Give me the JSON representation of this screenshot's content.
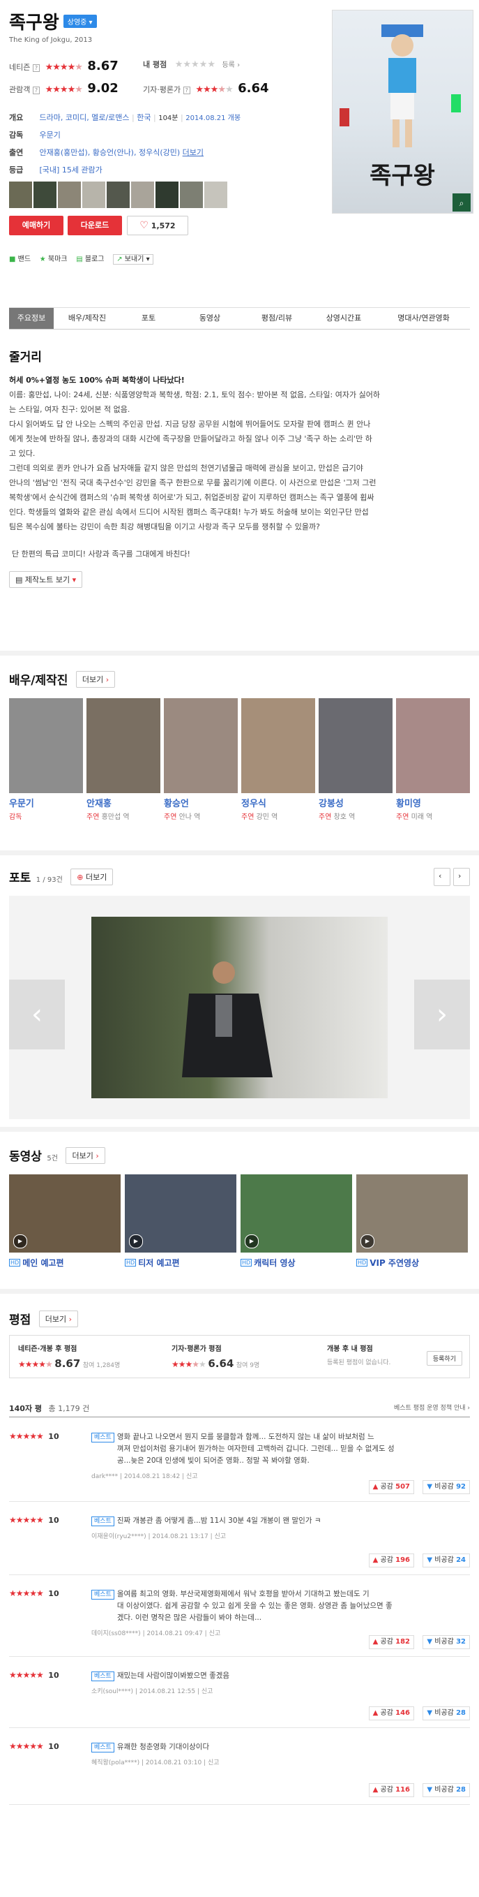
{
  "movie": {
    "title": "족구왕",
    "status_badge": "상영중",
    "subtitle": "The King of Jokgu, 2013",
    "netizen_label": "네티즌",
    "netizen_score": "8.67",
    "netizen_stars": 4.5,
    "my_rating_label": "내 평점",
    "register_label": "등록",
    "audience_label": "관람객",
    "audience_score": "9.02",
    "critic_label": "기자·평론가",
    "critic_score": "6.64",
    "genre_label": "개요",
    "genre": "드라마, 코미디, 멜로/로맨스",
    "country": "한국",
    "runtime": "104분",
    "release": "2014.08.21 개봉",
    "director_label": "감독",
    "director": "우문기",
    "cast_label": "출연",
    "cast": "안재홍(홍만섭), 황승언(안나), 정우식(강민)",
    "cast_more": "더보기",
    "grade_label": "등급",
    "grade": "[국내] 15세 관람가",
    "reserve_label": "예매하기",
    "download_label": "다운로드",
    "like_count": "1,572",
    "share_items": [
      "밴드",
      "북마크",
      "블로그",
      "보내기"
    ]
  },
  "tabs": [
    "주요정보",
    "배우/제작진",
    "포토",
    "동영상",
    "평점/리뷰",
    "상영시간표",
    "명대사/연관영화"
  ],
  "synopsis": {
    "heading": "줄거리",
    "headline": "허세 0%+열정 농도 100% 슈퍼 복학생이 나타났다!",
    "lines": [
      "이름: 홍만섭, 나이: 24세, 신분: 식품영양학과 복학생, 학점: 2.1, 토익 점수: 받아본 적 없음, 스타일: 여자가 싫어하",
      "는 스타일, 여자 친구: 있어본 적 없음.",
      " 다시 읽어봐도 답 안 나오는 스펙의 주인공 만섭. 지금 당장 공무원 시험에 뛰어들어도 모자랄 판에 캠퍼스 퀸 안나",
      "에게 첫눈에 반하질 않나, 총장과의 대화 시간에 족구장을 만들어달라고 하질 않나 이주 그냥 '족구 하는 소리'만 하",
      "고 있다.",
      " 그런데 의외로 퀸카 안나가 요즘 남자애들 같지 않은 만섭의 천연기념물급 매력에 관심을 보이고, 만섭은 급기야",
      "안나의 '썸남'인 '전직 국대 축구선수'인 강민을 족구 한판으로 무릎 꿇리기에 이른다. 이 사건으로 만섭은 '그저 그런",
      "복학생'에서 순식간에 캠퍼스의 '슈퍼 복학생 히어로'가 되고, 취업준비장 같이 지루하던 캠퍼스는 족구 열풍에 휩싸",
      "인다. 학생들의 열화와 같은 관심 속에서 드디어 시작된 캠퍼스 족구대회! 누가 봐도 허술해 보이는 외인구단 만섭",
      "팀은 복수심에 불타는 강민이 속한 최강 해병대팀을 이기고 사랑과 족구 모두를 쟁취할 수 있을까?"
    ],
    "closing": "단 한편의 특급 코미디! 사랑과 족구를 그대에게 바친다!",
    "notes_button": "제작노트 보기"
  },
  "cast_section": {
    "heading": "배우/제작진",
    "more": "더보기",
    "people": [
      {
        "name": "우문기",
        "role": "감독",
        "char": ""
      },
      {
        "name": "안재홍",
        "role": "주연",
        "char": "홍만섭 역"
      },
      {
        "name": "황승언",
        "role": "주연",
        "char": "안나 역"
      },
      {
        "name": "정우식",
        "role": "주연",
        "char": "강민 역"
      },
      {
        "name": "강봉성",
        "role": "주연",
        "char": "창호 역"
      },
      {
        "name": "황미영",
        "role": "주연",
        "char": "미래 역"
      }
    ]
  },
  "photo_section": {
    "heading": "포토",
    "counter": "1 / 93건",
    "more": "더보기"
  },
  "video_section": {
    "heading": "동영상",
    "count": "5건",
    "more": "더보기",
    "hd_label": "HD",
    "videos": [
      "메인 예고편",
      "티저 예고편",
      "캐릭터 영상",
      "VIP 주연영상"
    ]
  },
  "rating_section": {
    "heading": "평점",
    "more": "더보기",
    "netizen_box_label": "네티즌·개봉 후 평점",
    "netizen_score": "8.67",
    "netizen_count": "참여 1,284명",
    "critic_box_label": "기자·평론가 평점",
    "critic_score": "6.64",
    "critic_count": "참여 9명",
    "after_box_label": "개봉 후 내 평점",
    "after_box_text": "등록된 평점이 없습니다.",
    "register_button": "등록하기",
    "summary_prefix": "140자 평",
    "summary_total": "총 1,179 건",
    "guide_link": "베스트 평점 운영 정책 안내",
    "reviews": [
      {
        "score": "10",
        "best": "베스트",
        "text": [
          "영화 끝나고 나오면서 뭔지 모를 뭉클함과 함께... 도전하지 않는 내 삶이 바보처럼 느",
          "껴져 만섭이처럼 용기내어 뭔가하는 여자한테 고백하러 갑니다. 그런데... 믿을 수 없게도 성",
          "공...늦은 20대 인생에 빛이 되어준 영화.. 정말 꼭 봐야할 영화."
        ],
        "user": "dark****",
        "date": "2014.08.21 18:42",
        "report": "신고",
        "up": "507",
        "down": "92"
      },
      {
        "score": "10",
        "best": "베스트",
        "text": [
          "진짜 개봉관 좀 어떻게 좀...밤 11시 30분 4일 개봉이 왠 말인가 ㅋ"
        ],
        "user": "이재윤이(ryu2****)",
        "date": "2014.08.21 13:17",
        "report": "신고",
        "up": "196",
        "down": "24"
      },
      {
        "score": "10",
        "best": "베스트",
        "text": [
          "올여름 최고의 영화. 부산국제영화제에서 워낙 호평을 받아서 기대하고 봤는데도 기",
          "대 이상이였다. 쉽게 공감할 수 있고 쉽게 웃을 수 있는 좋은 영화. 상영관 좀 늘어났으면 좋",
          "겠다. 이런 명작은 많은 사람들이 봐야 하는데..."
        ],
        "user": "데이지(ss08****)",
        "date": "2014.08.21 09:47",
        "report": "신고",
        "up": "182",
        "down": "32"
      },
      {
        "score": "10",
        "best": "베스트",
        "text": [
          "재밌는데 사람이많이봐봤으면 좋겠음"
        ],
        "user": "소키(soul****)",
        "date": "2014.08.21 12:55",
        "report": "신고",
        "up": "146",
        "down": "28"
      },
      {
        "score": "10",
        "best": "베스트",
        "text": [
          "유쾌한 청춘영화 기대이상이다"
        ],
        "user": "혜직왕(pola****)",
        "date": "2014.08.21 03:10",
        "report": "신고",
        "up": "116",
        "down": "28"
      }
    ],
    "up_label": "공감",
    "down_label": "비공감"
  },
  "colors": {
    "accent_red": "#e53238",
    "link_blue": "#3a6cc6",
    "badge_blue": "#2d8ae8"
  },
  "icons": [
    "question-icon",
    "heart-icon",
    "arrow-left-icon",
    "arrow-right-icon",
    "play-icon",
    "zoom-icon",
    "chevron-down-icon"
  ]
}
